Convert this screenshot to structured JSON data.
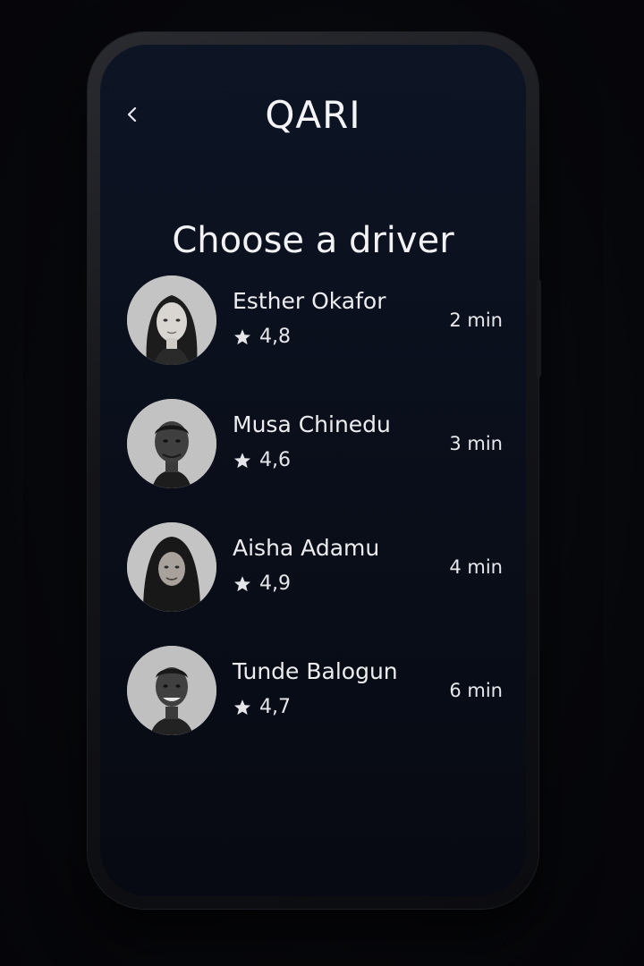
{
  "app": {
    "title": "QARI"
  },
  "header": {
    "back_icon": "chevron-left-icon"
  },
  "page": {
    "title": "Choose a driver"
  },
  "drivers": [
    {
      "name": "Esther Okafor",
      "rating": "4,8",
      "eta": "2 min"
    },
    {
      "name": "Musa Chinedu",
      "rating": "4,6",
      "eta": "3 min"
    },
    {
      "name": "Aisha Adamu",
      "rating": "4,9",
      "eta": "4 min"
    },
    {
      "name": "Tunde Balogun",
      "rating": "4,7",
      "eta": "6 min"
    }
  ],
  "icons": {
    "rating": "star-icon"
  },
  "colors": {
    "screen_background": "#0b1120",
    "text": "#f2f2f4",
    "avatar_background": "#bcbcbc"
  }
}
